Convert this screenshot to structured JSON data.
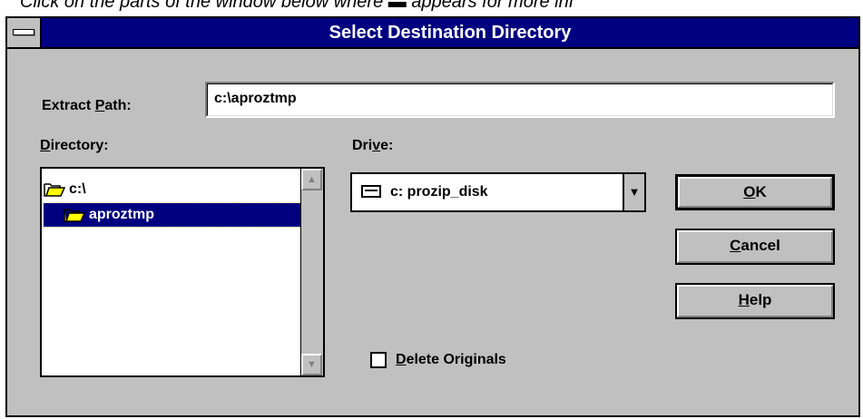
{
  "caption": "Click on the parts of the window below where ▬ appears for more inf",
  "dialog": {
    "title": "Select Destination Directory",
    "extract_path_label": "Extract Path:",
    "extract_path_value": "c:\\aproztmp",
    "directory_label": "Directory:",
    "directory_items": [
      {
        "label": "c:\\",
        "icon": "open-folder-icon"
      },
      {
        "label": "aproztmp",
        "icon": "open-folder-icon",
        "selected": true
      }
    ],
    "drive_label": "Drive:",
    "drive_value": "c: prozip_disk",
    "ok_label": "OK",
    "cancel_label": "Cancel",
    "help_label": "Help",
    "delete_originals_label": "Delete Originals",
    "delete_originals_checked": false
  },
  "colors": {
    "titlebar": "#000080",
    "face": "#c0c0c0",
    "selection": "#000080"
  }
}
